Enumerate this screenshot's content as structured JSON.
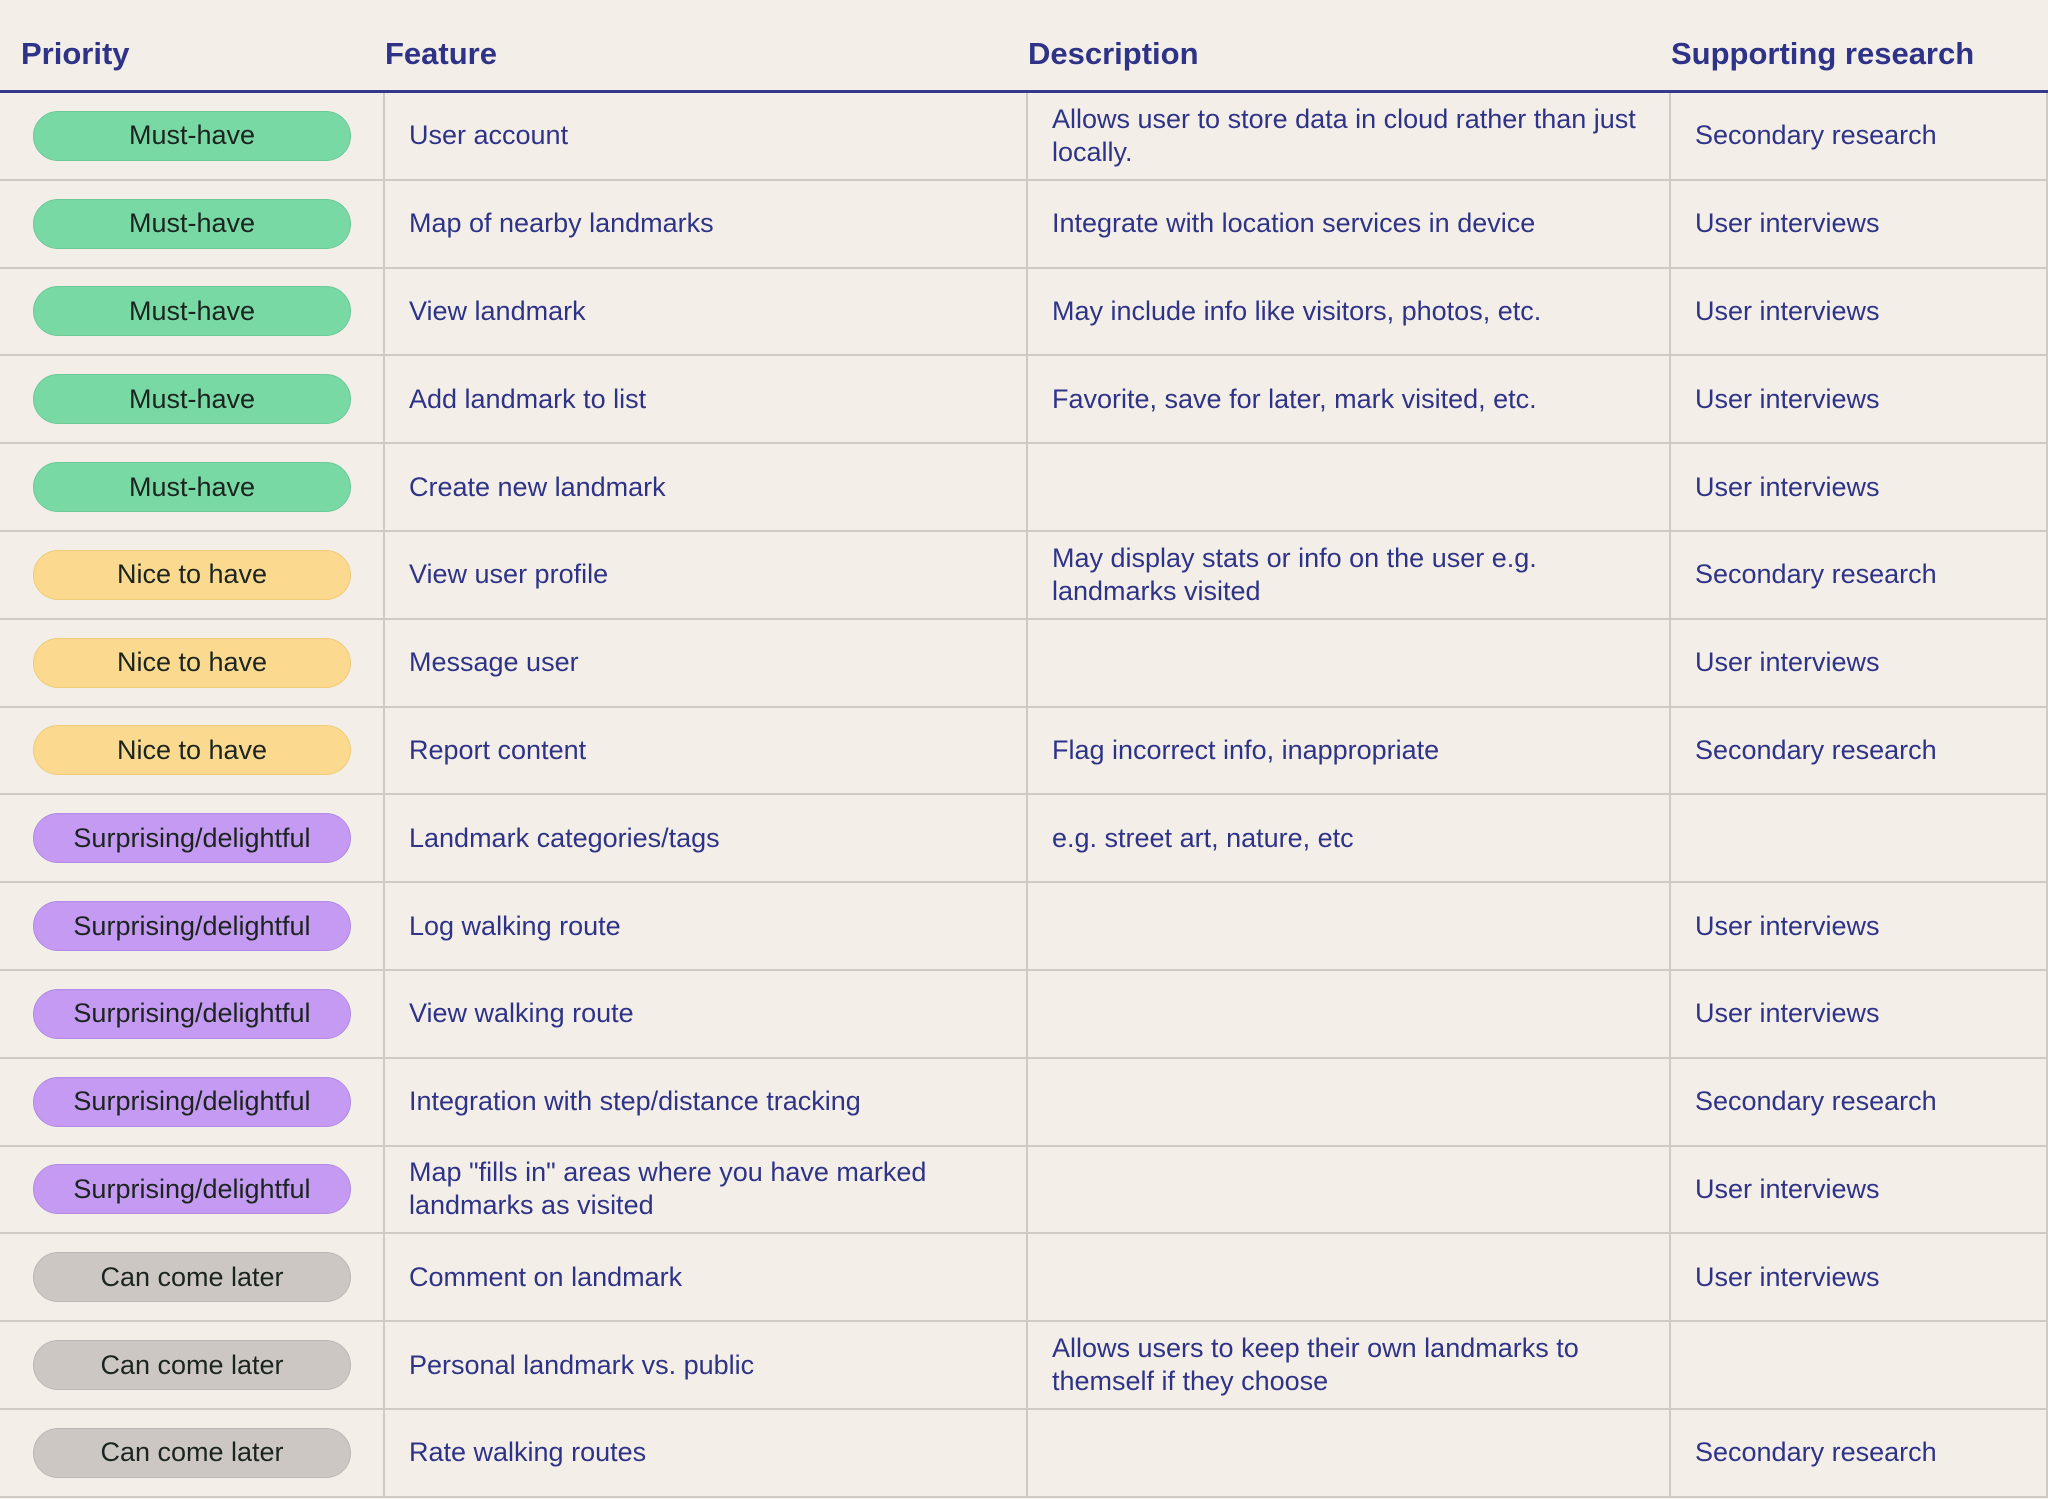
{
  "headers": {
    "priority": "Priority",
    "feature": "Feature",
    "description": "Description",
    "research": "Supporting research"
  },
  "priority_colors": {
    "Must-have": "#79d9a4",
    "Nice to have": "#fbda8f",
    "Surprising/delightful": "#c49af2",
    "Can come later": "#ccc7c3"
  },
  "rows": [
    {
      "priority": "Must-have",
      "feature": "User account",
      "description": "Allows user to store data in cloud rather than just locally.",
      "research": "Secondary research"
    },
    {
      "priority": "Must-have",
      "feature": "Map of nearby landmarks",
      "description": "Integrate with location services in device",
      "research": "User interviews"
    },
    {
      "priority": "Must-have",
      "feature": "View landmark",
      "description": "May include info like visitors, photos, etc.",
      "research": "User interviews"
    },
    {
      "priority": "Must-have",
      "feature": "Add landmark to list",
      "description": "Favorite, save for later, mark visited, etc.",
      "research": "User interviews"
    },
    {
      "priority": "Must-have",
      "feature": "Create new landmark",
      "description": "",
      "research": "User interviews"
    },
    {
      "priority": "Nice to have",
      "feature": "View user profile",
      "description": "May display stats or info on the user e.g. landmarks visited",
      "research": "Secondary research"
    },
    {
      "priority": "Nice to have",
      "feature": "Message user",
      "description": "",
      "research": "User interviews"
    },
    {
      "priority": "Nice to have",
      "feature": "Report content",
      "description": "Flag incorrect info, inappropriate",
      "research": "Secondary research"
    },
    {
      "priority": "Surprising/delightful",
      "feature": "Landmark categories/tags",
      "description": "e.g. street art, nature, etc",
      "research": ""
    },
    {
      "priority": "Surprising/delightful",
      "feature": "Log walking route",
      "description": "",
      "research": "User interviews"
    },
    {
      "priority": "Surprising/delightful",
      "feature": "View walking route",
      "description": "",
      "research": "User interviews"
    },
    {
      "priority": "Surprising/delightful",
      "feature": "Integration with step/distance tracking",
      "description": "",
      "research": "Secondary research"
    },
    {
      "priority": "Surprising/delightful",
      "feature": "Map \"fills in\" areas where you have marked landmarks as visited",
      "description": "",
      "research": "User interviews"
    },
    {
      "priority": "Can come later",
      "feature": "Comment on landmark",
      "description": "",
      "research": "User interviews"
    },
    {
      "priority": "Can come later",
      "feature": "Personal landmark vs. public",
      "description": "Allows users to keep their own landmarks to themself if they choose",
      "research": ""
    },
    {
      "priority": "Can come later",
      "feature": "Rate walking routes",
      "description": "",
      "research": "Secondary research"
    }
  ]
}
